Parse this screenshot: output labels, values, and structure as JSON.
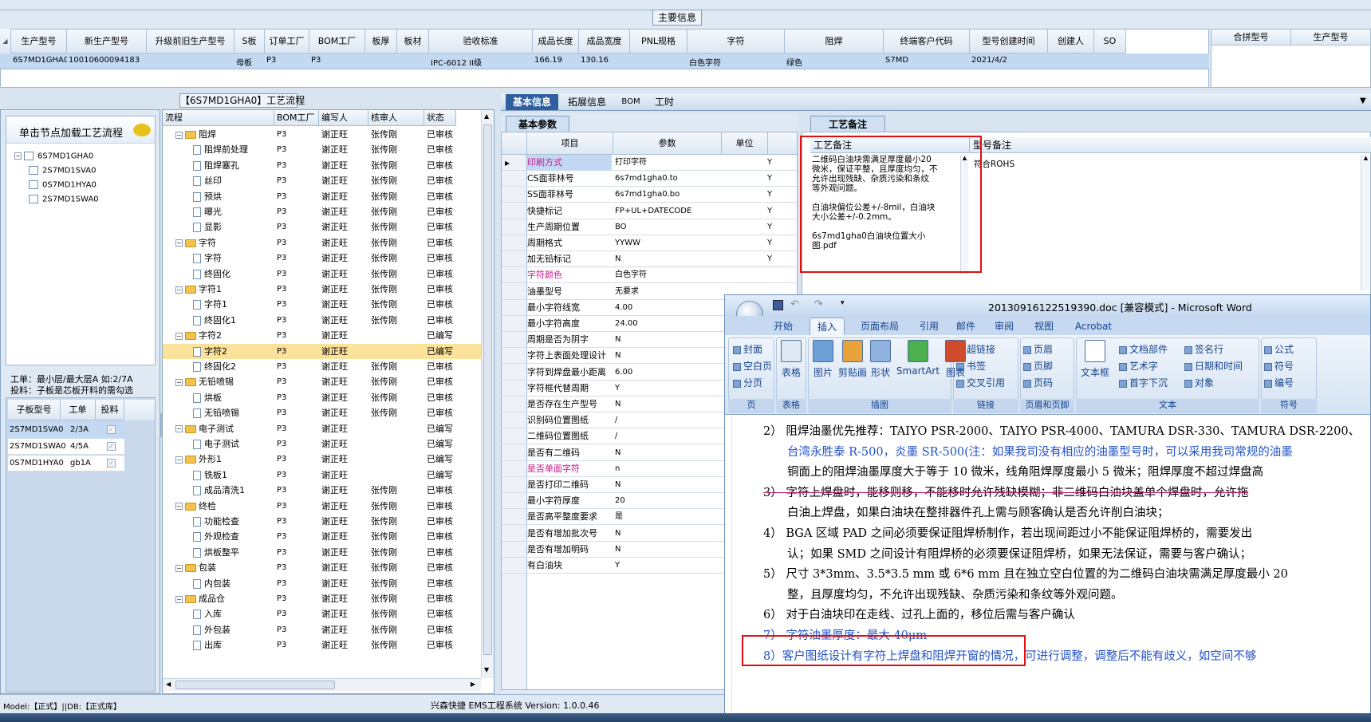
{
  "top_section_title": "主要信息",
  "top_grid": {
    "headers": [
      "生产型号",
      "新生产型号",
      "升级前旧生产型号",
      "S板",
      "订单工厂",
      "BOM工厂",
      "板厚",
      "板材",
      "验收标准",
      "成品长度",
      "成品宽度",
      "PNL规格",
      "字符",
      "阻焊",
      "终端客户代码",
      "型号创建时间",
      "创建人",
      "SO"
    ],
    "row": [
      "6S7MD1GHA0",
      "10010600094183",
      "",
      "母板",
      "P3",
      "P3",
      "",
      "",
      "IPC-6012 II级",
      "166.19",
      "130.16",
      "",
      "白色字符",
      "绿色",
      "S7MD",
      "2021/4/2",
      "",
      ""
    ],
    "side_headers": [
      "合拼型号",
      "生产型号"
    ]
  },
  "left_panel": {
    "title": "单击节点加载工艺流程",
    "tree": [
      "6S7MD1GHA0",
      "2S7MD1SVA0",
      "0S7MD1HYA0",
      "2S7MD1SWA0"
    ],
    "info_line1": "工单：最小层/最大层A 如:2/7A",
    "info_line2": "投料：子板是芯板开料的需勾选",
    "sub_headers": [
      "子板型号",
      "工单",
      "投料"
    ],
    "sub_rows": [
      [
        "2S7MD1SVA0",
        "2/3A"
      ],
      [
        "2S7MD1SWA0",
        "4/5A"
      ],
      [
        "0S7MD1HYA0",
        "gb1A"
      ]
    ]
  },
  "flow_panel": {
    "title": "【6S7MD1GHA0】工艺流程",
    "headers": [
      "流程",
      "BOM工厂",
      "编写人",
      "核审人",
      "状态"
    ],
    "rows": [
      {
        "name": "阻焊",
        "level": 0,
        "bom": "P3",
        "writer": "谢正旺",
        "checker": "张传刚",
        "status": "已审核"
      },
      {
        "name": "阻焊前处理",
        "level": 1,
        "bom": "P3",
        "writer": "谢正旺",
        "checker": "张传刚",
        "status": "已审核"
      },
      {
        "name": "阻焊塞孔",
        "level": 1,
        "bom": "P3",
        "writer": "谢正旺",
        "checker": "张传刚",
        "status": "已审核"
      },
      {
        "name": "丝印",
        "level": 1,
        "bom": "P3",
        "writer": "谢正旺",
        "checker": "张传刚",
        "status": "已审核"
      },
      {
        "name": "预烘",
        "level": 1,
        "bom": "P3",
        "writer": "谢正旺",
        "checker": "张传刚",
        "status": "已审核"
      },
      {
        "name": "曝光",
        "level": 1,
        "bom": "P3",
        "writer": "谢正旺",
        "checker": "张传刚",
        "status": "已审核"
      },
      {
        "name": "显影",
        "level": 1,
        "bom": "P3",
        "writer": "谢正旺",
        "checker": "张传刚",
        "status": "已审核"
      },
      {
        "name": "字符",
        "level": 0,
        "bom": "P3",
        "writer": "谢正旺",
        "checker": "张传刚",
        "status": "已审核"
      },
      {
        "name": "字符",
        "level": 1,
        "bom": "P3",
        "writer": "谢正旺",
        "checker": "张传刚",
        "status": "已审核"
      },
      {
        "name": "终固化",
        "level": 1,
        "bom": "P3",
        "writer": "谢正旺",
        "checker": "张传刚",
        "status": "已审核"
      },
      {
        "name": "字符1",
        "level": 0,
        "bom": "P3",
        "writer": "谢正旺",
        "checker": "张传刚",
        "status": "已审核"
      },
      {
        "name": "字符1",
        "level": 1,
        "bom": "P3",
        "writer": "谢正旺",
        "checker": "张传刚",
        "status": "已审核"
      },
      {
        "name": "终固化1",
        "level": 1,
        "bom": "P3",
        "writer": "谢正旺",
        "checker": "张传刚",
        "status": "已审核"
      },
      {
        "name": "字符2",
        "level": 0,
        "bom": "P3",
        "writer": "谢正旺",
        "checker": "",
        "status": "已编写"
      },
      {
        "name": "字符2",
        "level": 1,
        "bom": "P3",
        "writer": "谢正旺",
        "checker": "",
        "status": "已编写",
        "selected": true
      },
      {
        "name": "终固化2",
        "level": 1,
        "bom": "P3",
        "writer": "谢正旺",
        "checker": "张传刚",
        "status": "已审核"
      },
      {
        "name": "无铅喷锡",
        "level": 0,
        "bom": "P3",
        "writer": "谢正旺",
        "checker": "张传刚",
        "status": "已审核"
      },
      {
        "name": "烘板",
        "level": 1,
        "bom": "P3",
        "writer": "谢正旺",
        "checker": "张传刚",
        "status": "已审核"
      },
      {
        "name": "无铅喷锡",
        "level": 1,
        "bom": "P3",
        "writer": "谢正旺",
        "checker": "张传刚",
        "status": "已审核"
      },
      {
        "name": "电子测试",
        "level": 0,
        "bom": "P3",
        "writer": "谢正旺",
        "checker": "",
        "status": "已编写"
      },
      {
        "name": "电子测试",
        "level": 1,
        "bom": "P3",
        "writer": "谢正旺",
        "checker": "",
        "status": "已编写"
      },
      {
        "name": "外形1",
        "level": 0,
        "bom": "P3",
        "writer": "谢正旺",
        "checker": "",
        "status": "已编写"
      },
      {
        "name": "铣板1",
        "level": 1,
        "bom": "P3",
        "writer": "谢正旺",
        "checker": "",
        "status": "已编写"
      },
      {
        "name": "成品清洗1",
        "level": 1,
        "bom": "P3",
        "writer": "谢正旺",
        "checker": "张传刚",
        "status": "已审核"
      },
      {
        "name": "终检",
        "level": 0,
        "bom": "P3",
        "writer": "谢正旺",
        "checker": "张传刚",
        "status": "已审核"
      },
      {
        "name": "功能检查",
        "level": 1,
        "bom": "P3",
        "writer": "谢正旺",
        "checker": "张传刚",
        "status": "已审核"
      },
      {
        "name": "外观检查",
        "level": 1,
        "bom": "P3",
        "writer": "谢正旺",
        "checker": "张传刚",
        "status": "已审核"
      },
      {
        "name": "烘板整平",
        "level": 1,
        "bom": "P3",
        "writer": "谢正旺",
        "checker": "张传刚",
        "status": "已审核"
      },
      {
        "name": "包装",
        "level": 0,
        "bom": "P3",
        "writer": "谢正旺",
        "checker": "张传刚",
        "status": "已审核"
      },
      {
        "name": "内包装",
        "level": 1,
        "bom": "P3",
        "writer": "谢正旺",
        "checker": "张传刚",
        "status": "已审核"
      },
      {
        "name": "成品仓",
        "level": 0,
        "bom": "P3",
        "writer": "谢正旺",
        "checker": "张传刚",
        "status": "已审核"
      },
      {
        "name": "入库",
        "level": 1,
        "bom": "P3",
        "writer": "谢正旺",
        "checker": "张传刚",
        "status": "已审核"
      },
      {
        "name": "外包装",
        "level": 1,
        "bom": "P3",
        "writer": "谢正旺",
        "checker": "张传刚",
        "status": "已审核"
      },
      {
        "name": "出库",
        "level": 1,
        "bom": "P3",
        "writer": "谢正旺",
        "checker": "张传刚",
        "status": "已审核"
      }
    ]
  },
  "detail_tabs": [
    "基本信息",
    "拓展信息",
    "BOM",
    "工时"
  ],
  "params_panel": {
    "tab": "基本参数",
    "headers": [
      "项目",
      "参数",
      "单位"
    ],
    "rows": [
      {
        "k": "印刷方式",
        "v": "打印字符",
        "y": "Y",
        "hl": true
      },
      {
        "k": "CS面菲林号",
        "v": "6s7md1gha0.to",
        "y": "Y"
      },
      {
        "k": "SS面菲林号",
        "v": "6s7md1gha0.bo",
        "y": "Y"
      },
      {
        "k": "快捷标记",
        "v": "FP+UL+DATECODE",
        "y": "Y"
      },
      {
        "k": "生产周期位置",
        "v": "BO",
        "y": "Y"
      },
      {
        "k": "周期格式",
        "v": "YYWW",
        "y": "Y"
      },
      {
        "k": "加无铅标记",
        "v": "N",
        "y": "Y"
      },
      {
        "k": "字符颜色",
        "v": "白色字符",
        "y": "",
        "hl": true
      },
      {
        "k": "油墨型号",
        "v": "无要求",
        "y": ""
      },
      {
        "k": "最小字符线宽",
        "v": "4.00",
        "y": ""
      },
      {
        "k": "最小字符高度",
        "v": "24.00",
        "y": ""
      },
      {
        "k": "周期是否为阴字",
        "v": "N",
        "y": ""
      },
      {
        "k": "字符上表面处理设计",
        "v": "N",
        "y": ""
      },
      {
        "k": "字符到焊盘最小距离",
        "v": "6.00",
        "y": ""
      },
      {
        "k": "字符框代替周期",
        "v": "Y",
        "y": ""
      },
      {
        "k": "是否存在生产型号",
        "v": "N",
        "y": ""
      },
      {
        "k": "识别码位置图纸",
        "v": "/",
        "y": ""
      },
      {
        "k": "二维码位置图纸",
        "v": "/",
        "y": ""
      },
      {
        "k": "是否有二维码",
        "v": "N",
        "y": ""
      },
      {
        "k": "是否单面字符",
        "v": "n",
        "y": "",
        "hl": true
      },
      {
        "k": "是否打印二维码",
        "v": "N",
        "y": ""
      },
      {
        "k": "最小字符厚度",
        "v": "20",
        "y": ""
      },
      {
        "k": "是否高平整度要求",
        "v": "是",
        "y": ""
      },
      {
        "k": "是否有增加批次号",
        "v": "N",
        "y": ""
      },
      {
        "k": "是否有增加明码",
        "v": "N",
        "y": ""
      },
      {
        "k": "有白油块",
        "v": "Y",
        "y": ""
      }
    ]
  },
  "notes_panel": {
    "tab": "工艺备注",
    "col1": "工艺备注",
    "col2": "型号备注",
    "note_lines": [
      "二维码白油块需满足厚度最小20",
      "微米，保证平整，且厚度均匀，不",
      "允许出现残缺、杂质污染和条纹",
      "等外观问题。",
      "",
      "白油块偏位公差+/-8mil，白油块",
      "大小公差+/-0.2mm。",
      "",
      "6s7md1gha0白油块位置大小",
      "图.pdf"
    ],
    "model_note": "符合ROHS"
  },
  "word": {
    "title": "20130916122519390.doc [兼容模式] - Microsoft Word",
    "tabs": [
      "开始",
      "插入",
      "页面布局",
      "引用",
      "邮件",
      "审阅",
      "视图",
      "Acrobat"
    ],
    "groups": [
      "页",
      "表格",
      "插图",
      "链接",
      "页眉和页脚",
      "文本",
      "符号"
    ],
    "page_btns": [
      "封面",
      "空白页",
      "分页"
    ],
    "table_btn": "表格",
    "illus_btns": [
      "图片",
      "剪贴画",
      "形状",
      "SmartArt",
      "图表"
    ],
    "link_btns": [
      "超链接",
      "书签",
      "交叉引用"
    ],
    "hf_btns": [
      "页眉",
      "页脚",
      "页码"
    ],
    "textbox_btn": "文本框",
    "text_btns": [
      "文档部件",
      "艺术字",
      "首字下沉"
    ],
    "text_btns2": [
      "签名行",
      "日期和时间",
      "对象"
    ],
    "sym_btns": [
      "公式",
      "符号",
      "编号"
    ],
    "doc_lines": [
      {
        "t": "2） 阻焊油墨优先推荐：TAIYO PSR-2000、TAIYO PSR-4000、TAMURA  DSR-330、TAMURA DSR-2200、",
        "c": ""
      },
      {
        "t": "台湾永胜泰 R-500，",
        "c": "blue",
        "t2": "炎墨 SR-500(注：如果我司没有相应的油墨型号时，可以采用我司常规的油墨",
        "c2": ""
      },
      {
        "t": "铜面上的阻焊油墨厚度大于等于 10 微米，线角阻焊厚度最小 5 微米；阻焊厚度不超过焊盘高",
        "c": ""
      },
      {
        "t": "3） 字符上焊盘时，能移则移，不能移时允许残缺模糊；非二维码白油块盖单个焊盘时，允许拖",
        "c": "strike"
      },
      {
        "t": "白油上焊盘，如果白油块在整排器件孔上需与顾客确认是否允许削白油块；",
        "c": ""
      },
      {
        "t": "4） BGA 区域 PAD 之间必须要保证阻焊桥制作，若出现间距过小不能保证阻焊桥的，需要发出",
        "c": ""
      },
      {
        "t": "认；如果 SMD 之间设计有阻焊桥的必须要保证阻焊桥，如果无法保证，需要与客户确认；",
        "c": ""
      },
      {
        "t": "5） 尺寸 3*3mm、3.5*3.5 mm 或 6*6 mm 且在独立空白位置的为二维码白油块需满足厚度最小 20",
        "c": ""
      },
      {
        "t": "整，且厚度均匀，不允许出现残缺、杂质污染和条纹等外观问题。",
        "c": ""
      },
      {
        "t": "6） 对于白油块印在走线、过孔上面的，移位后需与客户确认",
        "c": ""
      },
      {
        "t": "7） 字符油墨厚度：最大 40μm",
        "c": "blue"
      },
      {
        "t": "8）客户图纸设计有字符上焊盘和阻焊开窗的情况，可进行调整，调整后不能有歧义，如空间不够",
        "c": "blue"
      }
    ]
  },
  "status_bar": {
    "left": "Model:【正式】||DB:【正式库】",
    "center": "兴森快捷 EMS工程系统 Version: 1.0.0.46"
  }
}
